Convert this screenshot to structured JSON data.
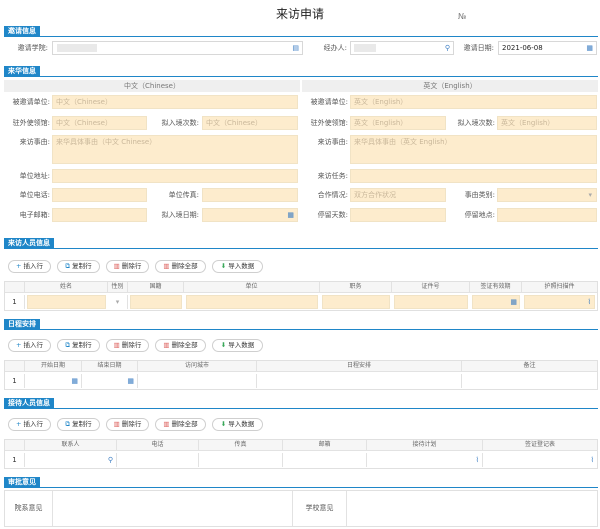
{
  "page": {
    "title": "来访申请",
    "number_label": "№"
  },
  "sections": {
    "invite": "邀请信息",
    "visitor": "来华信息",
    "persons": "来访人员信息",
    "schedule": "日程安排",
    "reception": "接待人员信息",
    "approval": "审批意见"
  },
  "invite": {
    "college_label": "邀请学院:",
    "agent_label": "经办人:",
    "date_label": "邀请日期:",
    "date_value": "2021-06-08"
  },
  "visitor": {
    "col_cn": "中文（Chinese）",
    "col_en": "英文（English）",
    "unit_label": "被邀请单位:",
    "embassy_label": "驻外使领馆:",
    "entry_times_label": "拟入境次数:",
    "reason_label": "来访事由:",
    "cn_placeholder": "中文（Chinese）",
    "en_placeholder": "英文（English）",
    "reason_cn_placeholder": "来华具体事由（中文 Chinese）",
    "reason_en_placeholder": "来华具体事由（英文 English）",
    "address_label": "单位地址:",
    "task_label": "来访任务:",
    "phone_label": "单位电话:",
    "fax_label": "单位传真:",
    "coop_label": "合作情况:",
    "coop_placeholder": "双方合作状况",
    "category_label": "事由类别:",
    "email_label": "电子邮箱:",
    "entry_date_label": "拟入境日期:",
    "stay_days_label": "停留天数:",
    "stay_place_label": "停留地点:"
  },
  "toolbar": {
    "insert": "插入行",
    "copy": "复制行",
    "delete": "删除行",
    "delete_all": "删除全部",
    "import": "导入数据"
  },
  "persons_table": {
    "headers": [
      "姓名",
      "性别",
      "国籍",
      "单位",
      "职务",
      "证件号",
      "签证有效期",
      "护照扫描件"
    ],
    "row_no": "1"
  },
  "schedule_table": {
    "headers": [
      "开始日期",
      "结束日期",
      "访问城市",
      "日程安排",
      "备注"
    ],
    "row_no": "1"
  },
  "reception_table": {
    "headers": [
      "联系人",
      "电话",
      "传真",
      "邮箱",
      "接待计划",
      "签证登记表"
    ],
    "row_no": "1"
  },
  "approval": {
    "dept_label": "院系意见",
    "school_label": "学校意见"
  },
  "colors": {
    "accent": "#1f86c8",
    "field_yellow": "#fdeccd"
  }
}
